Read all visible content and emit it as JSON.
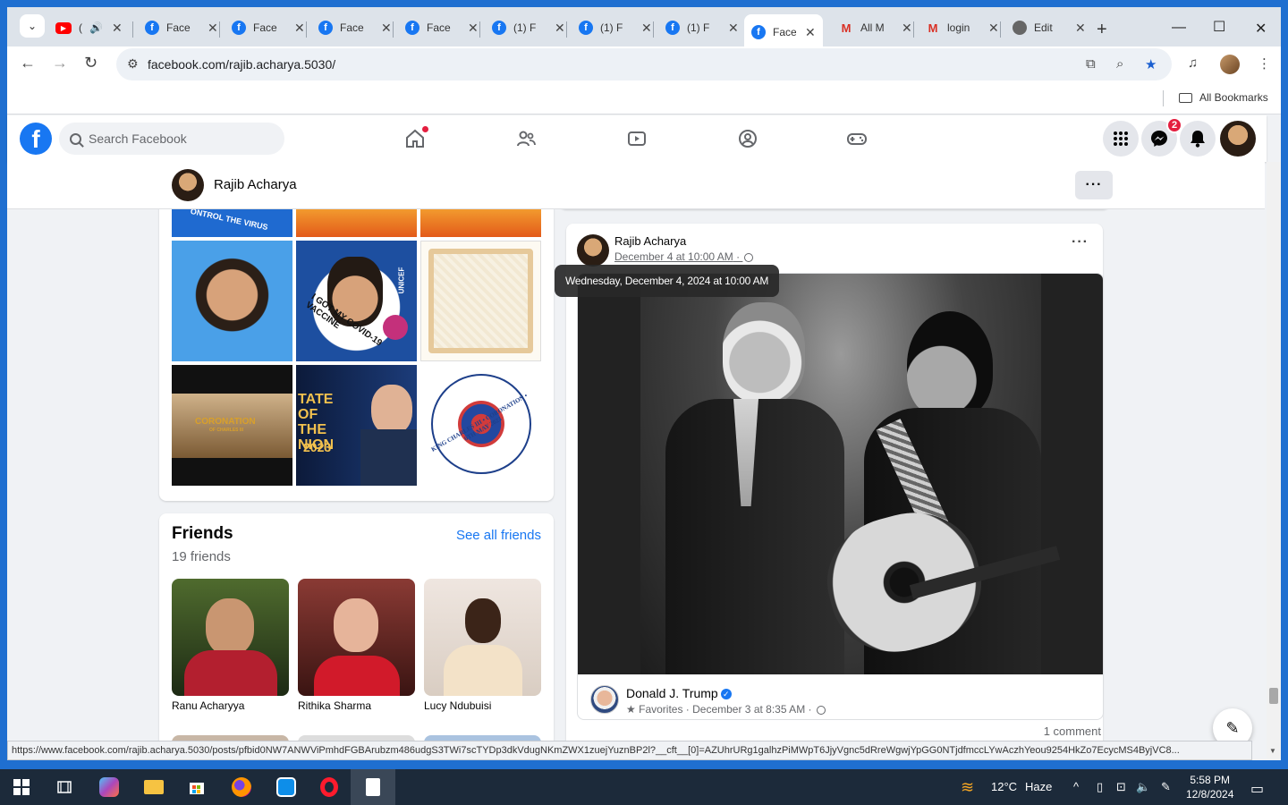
{
  "browser": {
    "tabs": [
      {
        "label": "(",
        "icon": "youtube-icon",
        "audio": true
      },
      {
        "label": "Face",
        "icon": "facebook-icon"
      },
      {
        "label": "Face",
        "icon": "facebook-icon"
      },
      {
        "label": "Face",
        "icon": "facebook-icon"
      },
      {
        "label": "Face",
        "icon": "facebook-icon"
      },
      {
        "label": "(1) F",
        "icon": "facebook-icon"
      },
      {
        "label": "(1) F",
        "icon": "facebook-icon"
      },
      {
        "label": "(1) F",
        "icon": "facebook-icon"
      },
      {
        "label": "Face",
        "icon": "facebook-icon",
        "active": true
      },
      {
        "label": "All M",
        "icon": "gmail-icon"
      },
      {
        "label": "login",
        "icon": "gmail-icon"
      },
      {
        "label": "Edit",
        "icon": "globe-icon"
      }
    ],
    "url": "facebook.com/rajib.acharya.5030/",
    "bookmarks_label": "All Bookmarks",
    "status_url": "https://www.facebook.com/rajib.acharya.5030/posts/pfbid0NW7ANWViPmhdFGBArubzm486udgS3TWi7scTYDp3dkVdugNKmZWX1zuejYuznBP2l?__cft__[0]=AZUhrURg1galhzPiMWpT6JjyVgnc5dRreWgwjYpGG0NTjdfmccLYwAczhYeou9254HkZo7EcycMS4ByjVC8..."
  },
  "facebook": {
    "search_placeholder": "Search Facebook",
    "messenger_badge": "2",
    "profile_name": "Rajib Acharya",
    "photos": {
      "tile_text_coronation": "CORONATION",
      "tile_text_coronation_sub": "OF CHARLES III",
      "tile_text_union": "TATE OF THE NION",
      "tile_text_union_year": "2023",
      "tile_text_virus": "ONTROL THE VIRUS",
      "tile_text_vaccine": "I GOT MY COVID-19 VACCINE",
      "tile_text_unicef": "UNICEF",
      "tile_text_emblem": "KING CHARLES III • CORONATION • 6TH MAY 2023"
    },
    "friends": {
      "title": "Friends",
      "count": "19 friends",
      "see_all": "See all friends",
      "list": [
        {
          "name": "Ranu Acharyya"
        },
        {
          "name": "Rithika Sharma"
        },
        {
          "name": "Lucy Ndubuisi"
        }
      ]
    },
    "post": {
      "author": "Rajib Acharya",
      "date": "December 4 at 10:00 AM",
      "tooltip": "Wednesday, December 4, 2024 at 10:00 AM",
      "shared_author": "Donald J. Trump",
      "shared_meta": "Favorites · December 3 at 8:35 AM ·",
      "comments": "1 comment"
    }
  },
  "taskbar": {
    "weather": "12°C",
    "weather_desc": "Haze",
    "time": "5:58 PM",
    "date": "12/8/2024"
  }
}
